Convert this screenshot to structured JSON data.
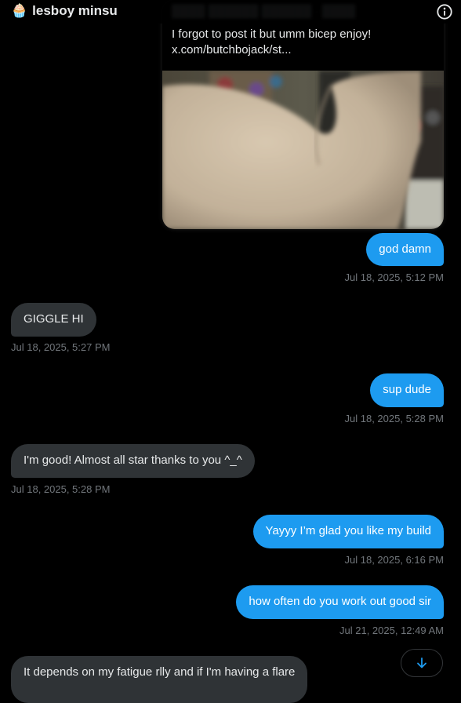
{
  "header": {
    "emoji": "🧁",
    "title": "lesboy minsu",
    "info_icon": "info-circle-icon"
  },
  "tweet_card": {
    "text_line1": "I forgot to post it but umm bicep enjoy!",
    "link": "x.com/butchbojack/st..."
  },
  "messages": [
    {
      "direction": "out",
      "text": "god damn",
      "time": "Jul 18, 2025, 5:12 PM"
    },
    {
      "direction": "in",
      "text": "GIGGLE HI",
      "time": "Jul 18, 2025, 5:27 PM"
    },
    {
      "direction": "out",
      "text": "sup dude",
      "time": "Jul 18, 2025, 5:28 PM"
    },
    {
      "direction": "in",
      "text": "I'm good! Almost all star thanks to you ^_^",
      "time": "Jul 18, 2025, 5:28 PM"
    },
    {
      "direction": "out",
      "text": "Yayyy I’m glad you like my build",
      "time": "Jul 18, 2025, 6:16 PM"
    },
    {
      "direction": "out",
      "text": "how often do you work out good sir",
      "time": "Jul 21, 2025, 12:49 AM"
    },
    {
      "direction": "in",
      "text": "It depends on my fatigue rlly and if I'm having a flare"
    }
  ],
  "colors": {
    "outgoing": "#1d9bf0",
    "incoming": "#2f3336",
    "background": "#000000"
  },
  "scroll_button": {
    "icon": "arrow-down-icon"
  }
}
